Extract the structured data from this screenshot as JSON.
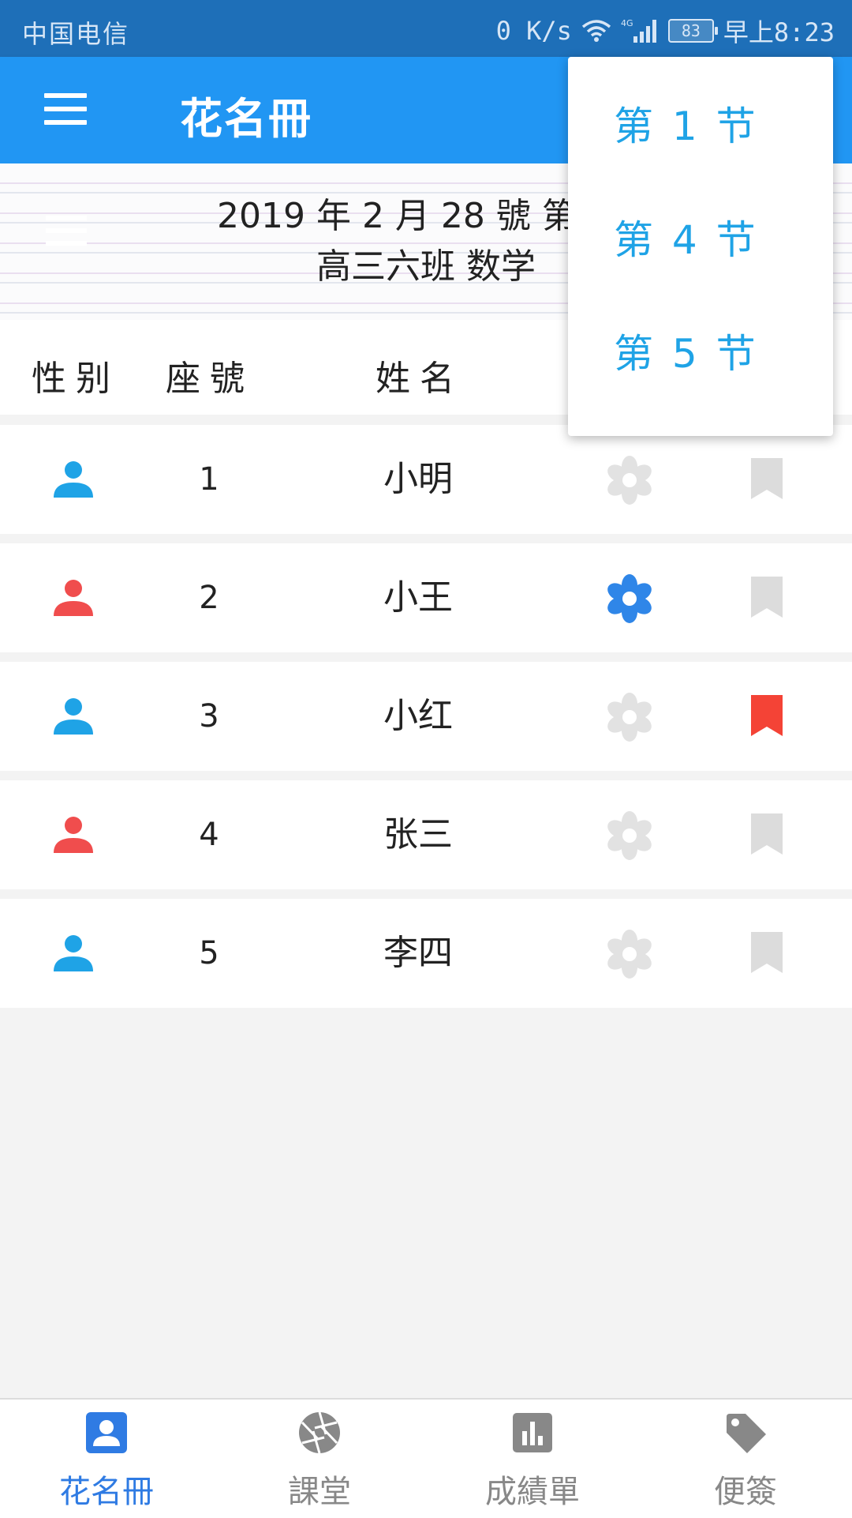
{
  "status_bar": {
    "carrier": "中国电信",
    "speed": "0 K/s",
    "network": "4G",
    "battery": "83",
    "time": "早上8:23"
  },
  "app_bar": {
    "title": "花名冊",
    "menu_icon": "hamburger-menu-icon"
  },
  "banner": {
    "line1": "2019 年 2 月 28 號 第",
    "line2": "高三六班 数学"
  },
  "columns": {
    "gender": "性别",
    "seat": "座號",
    "name": "姓名"
  },
  "students": [
    {
      "seat": "1",
      "name": "小明",
      "gender": "male",
      "flower_active": false,
      "bookmark_active": false
    },
    {
      "seat": "2",
      "name": "小王",
      "gender": "female",
      "flower_active": true,
      "bookmark_active": false
    },
    {
      "seat": "3",
      "name": "小红",
      "gender": "male",
      "flower_active": false,
      "bookmark_active": true
    },
    {
      "seat": "4",
      "name": "张三",
      "gender": "female",
      "flower_active": false,
      "bookmark_active": false
    },
    {
      "seat": "5",
      "name": "李四",
      "gender": "male",
      "flower_active": false,
      "bookmark_active": false
    }
  ],
  "dropdown": {
    "items": [
      "第 1 节",
      "第 4 节",
      "第 5 节"
    ]
  },
  "bottom_nav": {
    "items": [
      {
        "label": "花名冊",
        "icon": "person-badge-icon",
        "active": true
      },
      {
        "label": "課堂",
        "icon": "camera-aperture-icon",
        "active": false
      },
      {
        "label": "成績單",
        "icon": "bar-chart-icon",
        "active": false
      },
      {
        "label": "便簽",
        "icon": "tag-icon",
        "active": false
      }
    ]
  },
  "colors": {
    "status_bar": "#1e6fb8",
    "app_bar": "#2196f3",
    "male": "#1fa3e6",
    "female": "#f04d4d",
    "flower_active": "#2f86e8",
    "flower_inactive": "#e2e2e2",
    "bookmark_active": "#f44336",
    "bookmark_inactive": "#dcdcdc",
    "nav_active": "#2f7be3",
    "nav_inactive": "#888888",
    "dropdown_text": "#1fa3e6"
  }
}
